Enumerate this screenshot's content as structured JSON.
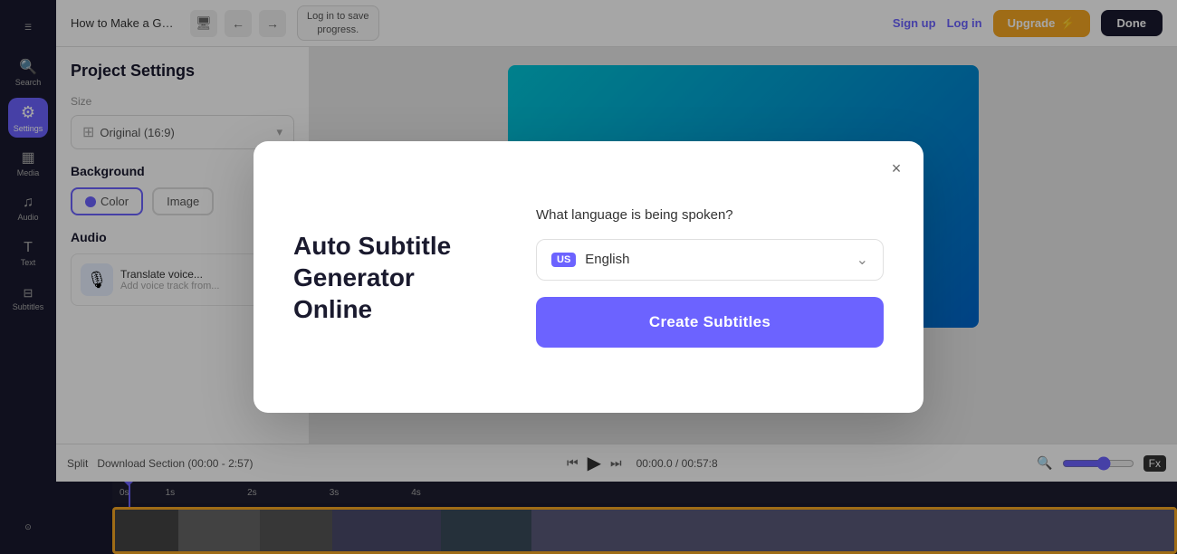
{
  "sidebar": {
    "items": [
      {
        "label": "☰",
        "sublabel": "",
        "active": false,
        "name": "menu"
      },
      {
        "label": "🔍",
        "sublabel": "Search",
        "active": false,
        "name": "search"
      },
      {
        "label": "⚙",
        "sublabel": "Settings",
        "active": true,
        "name": "settings"
      },
      {
        "label": "♪",
        "sublabel": "Media",
        "active": false,
        "name": "media"
      },
      {
        "label": "♫",
        "sublabel": "Audio",
        "active": false,
        "name": "audio"
      },
      {
        "label": "T",
        "sublabel": "Text",
        "active": false,
        "name": "text"
      },
      {
        "label": "⊟",
        "sublabel": "Subtitles",
        "active": false,
        "name": "subtitles"
      }
    ]
  },
  "topbar": {
    "title": "How to Make a Gam...",
    "icon1": "🖥",
    "log_progress_line1": "Log in to save",
    "log_progress_line2": "progress.",
    "sign_up_label": "Sign up",
    "log_in_label": "Log in",
    "upgrade_label": "Upgrade",
    "done_label": "Done"
  },
  "settings_panel": {
    "title": "Project Settings",
    "size_label": "Size",
    "size_value": "Original (16:9)",
    "background_label": "Background",
    "bg_option_color": "Color",
    "bg_option_image": "Image",
    "audio_label": "Audio",
    "audio_card_title": "Translate voice...",
    "audio_card_sub": "Add voice track from..."
  },
  "modal": {
    "heading": "Auto Subtitle Generator Online",
    "close_label": "×",
    "question": "What language is being spoken?",
    "language_badge": "US",
    "language_name": "English",
    "create_subtitles_label": "Create Subtitles"
  },
  "timeline": {
    "split_label": "Split",
    "download_label": "Download Section (00:00 - 2:57)",
    "timecode_current": "00:00.0",
    "timecode_total": "00:57:8",
    "zoom_label": "Fx"
  }
}
